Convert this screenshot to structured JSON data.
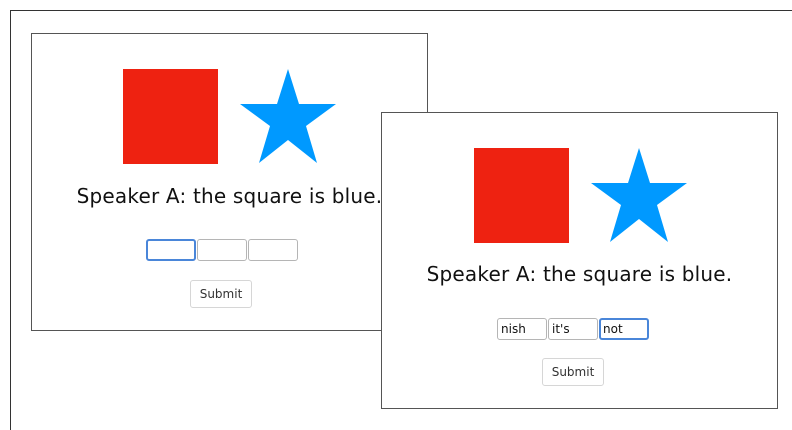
{
  "colors": {
    "square": "#ee2211",
    "star": "#0099ff",
    "focus_border": "#4a86d9"
  },
  "panels": [
    {
      "shapes": [
        {
          "kind": "square",
          "color": "#ee2211"
        },
        {
          "kind": "star",
          "color": "#0099ff"
        }
      ],
      "utterance": "Speaker A: the square is blue.",
      "inputs": [
        {
          "value": "",
          "focused": true
        },
        {
          "value": "",
          "focused": false
        },
        {
          "value": "",
          "focused": false
        }
      ],
      "submit_label": "Submit"
    },
    {
      "shapes": [
        {
          "kind": "square",
          "color": "#ee2211"
        },
        {
          "kind": "star",
          "color": "#0099ff"
        }
      ],
      "utterance": "Speaker A: the square is blue.",
      "inputs": [
        {
          "value": "nish",
          "focused": false
        },
        {
          "value": "it's",
          "focused": false
        },
        {
          "value": "not",
          "focused": true
        }
      ],
      "submit_label": "Submit"
    }
  ]
}
